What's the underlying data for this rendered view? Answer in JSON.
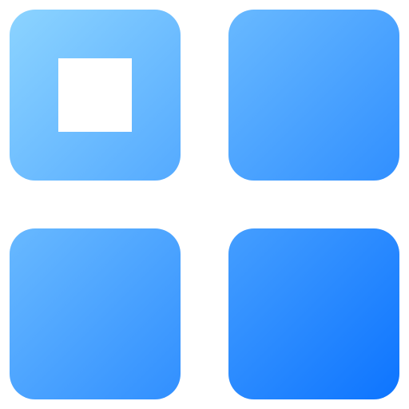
{
  "icon": {
    "name": "app-grid-icon",
    "tiles": [
      {
        "name": "tile-top-left",
        "has_selection_mark": true
      },
      {
        "name": "tile-top-right",
        "has_selection_mark": false
      },
      {
        "name": "tile-bottom-left",
        "has_selection_mark": false
      },
      {
        "name": "tile-bottom-right",
        "has_selection_mark": false
      }
    ],
    "colors": {
      "gradient_start": "#8fd6ff",
      "gradient_end": "#0a72ff",
      "mark": "#ffffff",
      "background": "#ffffff"
    }
  }
}
